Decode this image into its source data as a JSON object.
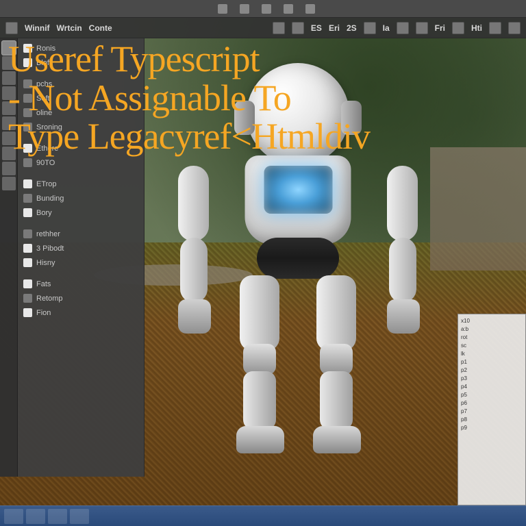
{
  "title_overlay": {
    "line1": "Useref Typescript",
    "line2": "- Not Assignable To",
    "line3": "Type Legacyref<Htmldiv"
  },
  "top_toolbar": {
    "items": [
      {
        "icon": "snap-icon",
        "label": ""
      },
      {
        "icon": "grid-icon",
        "label": ""
      },
      {
        "icon": "axis-icon",
        "label": ""
      },
      {
        "icon": "magnet-icon",
        "label": ""
      },
      {
        "icon": "link-icon",
        "label": ""
      }
    ]
  },
  "second_toolbar": {
    "items": [
      {
        "icon": "select-icon"
      },
      {
        "icon": "move-icon"
      },
      {
        "label": "ES"
      },
      {
        "label": "Eri"
      },
      {
        "label": "2S"
      },
      {
        "icon": "helper-icon"
      },
      {
        "label": "Ia"
      },
      {
        "icon": "cube-icon"
      },
      {
        "icon": "sphere-icon"
      },
      {
        "label": "Fri"
      },
      {
        "icon": "gear-icon"
      },
      {
        "label": "Hti"
      },
      {
        "icon": "camera-icon"
      },
      {
        "icon": "light-icon"
      }
    ]
  },
  "header_tabs": [
    {
      "label": "Winnif"
    },
    {
      "label": "Wrtcin"
    },
    {
      "label": "Conte"
    }
  ],
  "left_panel": {
    "items": [
      {
        "icon": "doc",
        "label": "Ronis"
      },
      {
        "icon": "doc",
        "label": "Bloff"
      },
      {
        "icon": "std",
        "label": "pchs"
      },
      {
        "icon": "std",
        "label": "Soft"
      },
      {
        "icon": "std",
        "label": "oline"
      },
      {
        "icon": "std",
        "label": "Sroning"
      },
      {
        "icon": "doc",
        "label": "Ethere"
      },
      {
        "icon": "std",
        "label": "90TO"
      },
      {
        "icon": "doc",
        "label": "ETrop"
      },
      {
        "icon": "std",
        "label": "Bunding"
      },
      {
        "icon": "doc",
        "label": "Bory"
      },
      {
        "icon": "std",
        "label": "rethher"
      },
      {
        "icon": "doc",
        "label": "3 Pibodt"
      },
      {
        "icon": "doc",
        "label": "Hisny"
      },
      {
        "icon": "doc",
        "label": "Fats"
      },
      {
        "icon": "std",
        "label": "Retomp"
      },
      {
        "icon": "doc",
        "label": "Fion"
      }
    ]
  },
  "tool_column": {
    "items": [
      "pointer-tool",
      "move-tool",
      "rotate-tool",
      "scale-tool",
      "box-tool",
      "edit-tool",
      "cut-tool",
      "paint-tool",
      "measure-tool",
      "snap-tool"
    ]
  },
  "right_mini": {
    "lines": [
      "x10",
      "a:b",
      "rot",
      "sc",
      "lk",
      "p1",
      "p2",
      "p3",
      "p4",
      "p5",
      "p6",
      "p7",
      "p8",
      "p9"
    ]
  },
  "taskbar": {
    "buttons": [
      "start-button",
      "app-1",
      "app-2",
      "app-3"
    ]
  },
  "colors": {
    "accent": "#f5a623",
    "panel": "#3e3e3e",
    "toolbar": "#4a4a4a",
    "taskbar": "#2a4a7a"
  }
}
